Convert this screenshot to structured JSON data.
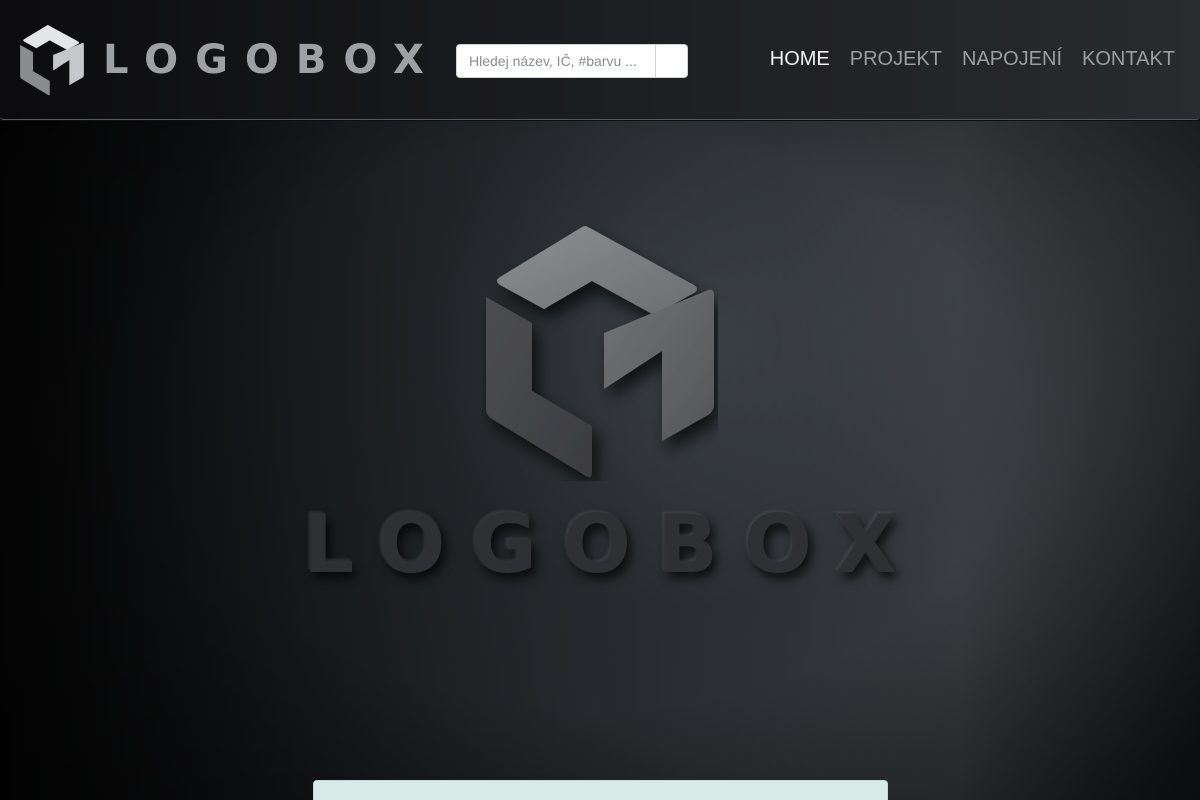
{
  "app": {
    "brand_name": "LOGOBOX"
  },
  "search": {
    "placeholder": "Hledej název, IČ, #barvu ...",
    "value": ""
  },
  "nav": {
    "items": [
      {
        "label": "HOME",
        "active": true
      },
      {
        "label": "PROJEKT",
        "active": false
      },
      {
        "label": "NAPOJENÍ",
        "active": false
      },
      {
        "label": "KONTAKT",
        "active": false
      }
    ]
  },
  "hero": {
    "brand_name": "LOGOBOX"
  },
  "icons": {
    "brand": "logobox-hexagon-icon",
    "search": "search-icon"
  },
  "colors": {
    "header_dark": "#0c0c0e",
    "header_light": "#2a2b2f",
    "nav_active": "#f2f2f2",
    "nav_inactive": "#9a9da1",
    "logo_gray": "#9ea0a3",
    "panel": "#d8e9e8"
  }
}
